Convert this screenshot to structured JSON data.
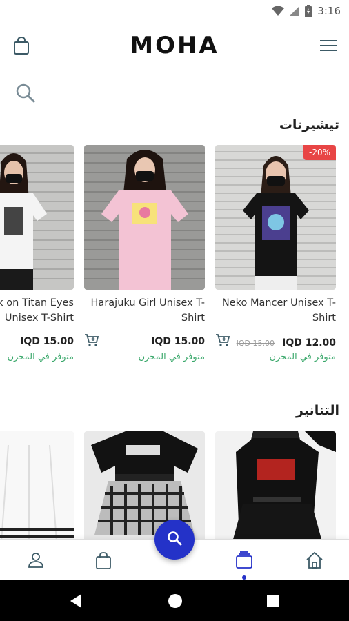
{
  "status_bar": {
    "time": "3:16",
    "icons": [
      "wifi-icon",
      "signal-icon",
      "battery-icon"
    ]
  },
  "header": {
    "logo": "MOHA",
    "cart_icon": "bag-icon",
    "menu_icon": "hamburger-menu-icon"
  },
  "search": {
    "icon": "search-icon"
  },
  "sections": [
    {
      "title": "تيشيرتات",
      "products": [
        {
          "name": "Neko Mancer Unisex T-Shirt",
          "price": "IQD 12.00",
          "old_price": "IQD 15.00",
          "stock": "متوفر في المخزن",
          "badge": "-20%"
        },
        {
          "name": "Harajuku Girl Unisex T-Shirt",
          "price": "IQD 15.00",
          "stock": "متوفر في المخزن"
        },
        {
          "name": "Attack on Titan Eyes Unisex T-Shirt",
          "price": "IQD 15.00",
          "stock": "متوفر في المخزن"
        }
      ]
    },
    {
      "title": "التنانير"
    }
  ],
  "bottom_nav": {
    "items": [
      "profile-icon",
      "bag-icon",
      "search-icon",
      "collections-icon",
      "home-icon"
    ],
    "active": "collections-icon"
  },
  "colors": {
    "accent": "#2432c8",
    "stock": "#3aa86b",
    "badge": "#e84545"
  }
}
